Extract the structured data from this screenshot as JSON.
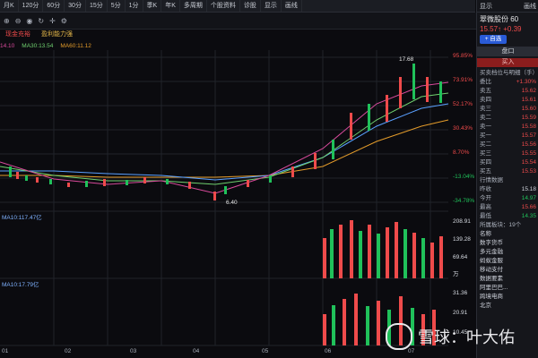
{
  "toolbar": {
    "items": [
      "月K",
      "120分",
      "60分",
      "30分",
      "15分",
      "5分",
      "1分",
      "季K",
      "年K",
      "多周期",
      "个股资料",
      "诊股",
      "显示",
      "画线"
    ]
  },
  "tabs": [
    {
      "label": "现金充裕",
      "tone": "red"
    },
    {
      "label": "盈利能力强",
      "tone": "red"
    }
  ],
  "ma_labels": [
    "14.10",
    "MA30:13.54",
    "MA60:11.12"
  ],
  "vol_labels": [
    "MA10:117.47亿",
    "MA10:17.79亿"
  ],
  "right_axis_top": [
    "95.85%",
    "73.91%",
    "52.17%",
    "30.43%",
    "8.70%",
    "-13.04%",
    "-34.78%"
  ],
  "right_axis_vol1": [
    "208.91",
    "139.28",
    "69.64",
    "万"
  ],
  "right_axis_vol2": [
    "31.36",
    "20.91",
    "10.45"
  ],
  "bottom_axis": [
    "01",
    "02",
    "03",
    "04",
    "05",
    "06",
    "07"
  ],
  "annotations": {
    "high": "17.68",
    "low": "6.40"
  },
  "rightpanel": {
    "header_left": "显示",
    "header_right": "画线",
    "stock_name": "翠微股份",
    "stock_code": "60",
    "price_line": "15.57↑ +0.39",
    "btn_add": "+ 自选",
    "section_title": "盘口",
    "buy_label": "买入",
    "sub_title": "买卖档位与明细（手）",
    "rows": [
      {
        "k": "委比",
        "v": "+1.30%",
        "tone": "red"
      },
      {
        "k": "卖五",
        "v": "15.62",
        "tone": "red"
      },
      {
        "k": "卖四",
        "v": "15.61",
        "tone": "red"
      },
      {
        "k": "卖三",
        "v": "15.60",
        "tone": "red"
      },
      {
        "k": "卖二",
        "v": "15.59",
        "tone": "red"
      },
      {
        "k": "卖一",
        "v": "15.58",
        "tone": "red"
      },
      {
        "k": "买一",
        "v": "15.57",
        "tone": "red"
      },
      {
        "k": "买二",
        "v": "15.56",
        "tone": "red"
      },
      {
        "k": "买三",
        "v": "15.55",
        "tone": "red"
      },
      {
        "k": "买四",
        "v": "15.54",
        "tone": "red"
      },
      {
        "k": "买五",
        "v": "15.53",
        "tone": "red"
      }
    ],
    "quote_title": "行情数据",
    "quote_rows": [
      {
        "k": "昨收",
        "v": "15.18"
      },
      {
        "k": "今开",
        "v": "14.97"
      },
      {
        "k": "最高",
        "v": "15.66"
      },
      {
        "k": "最低",
        "v": "14.35"
      }
    ],
    "board_title": "所属板块：19个",
    "board_rows": [
      "名称",
      "数字货币",
      "多元金融",
      "蚂蚁金服",
      "移动支付",
      "数据要素",
      "阿里巴巴...",
      "跨境电商",
      "北京"
    ]
  },
  "watermark": {
    "text": "雪球：叶大佑"
  },
  "colors": {
    "up": "#ef4b4b",
    "down": "#20c15a",
    "bg": "#0b0b0f"
  }
}
